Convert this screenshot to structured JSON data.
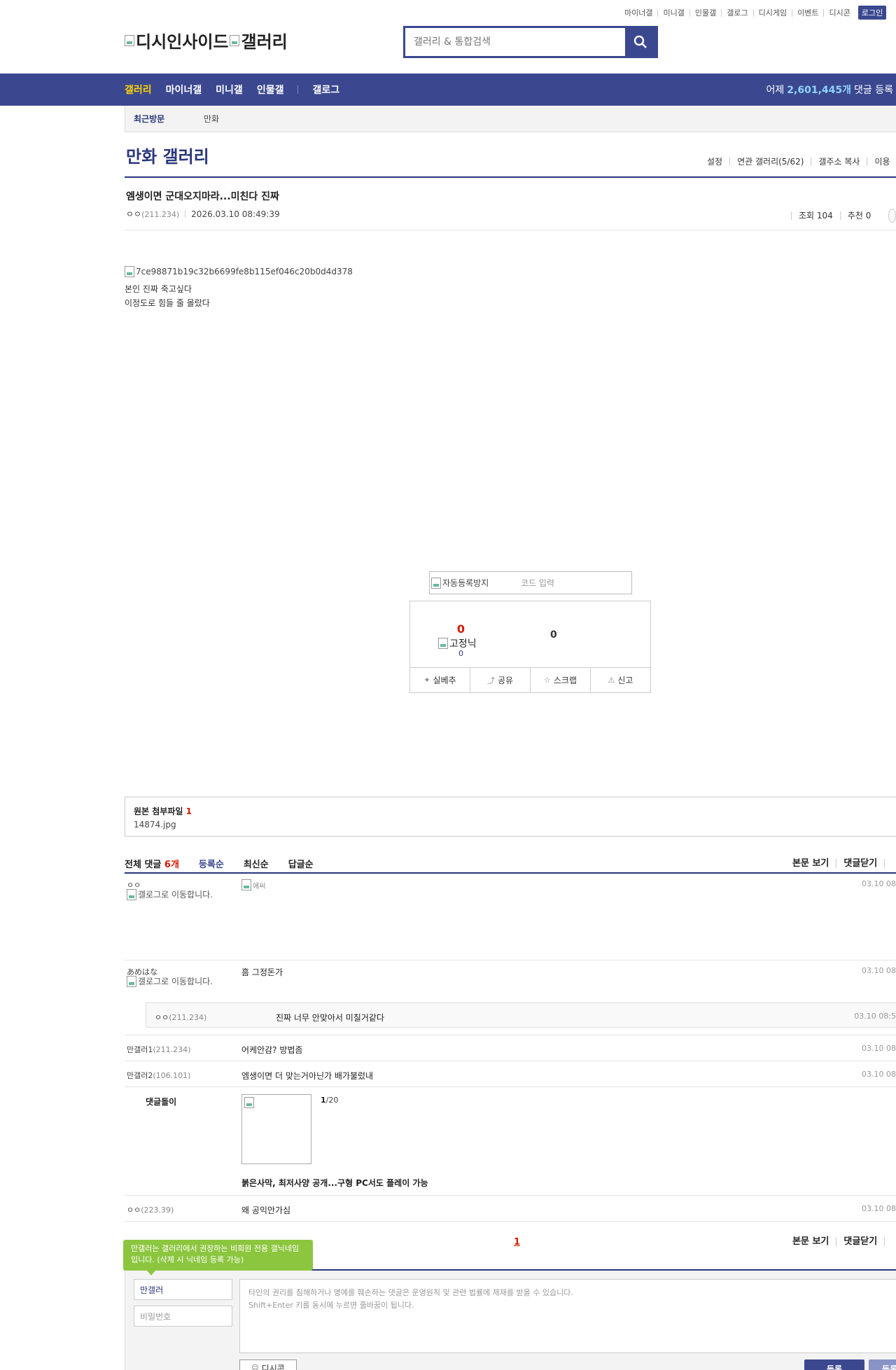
{
  "util_nav": [
    "마이너갤",
    "미니갤",
    "인물갤",
    "갤로그",
    "디시게임",
    "이벤트",
    "디시콘"
  ],
  "login_label": "로그인",
  "logo": {
    "alt1": "디시인사이드",
    "alt2": "갤러리"
  },
  "search": {
    "placeholder": "갤러리 & 통합검색"
  },
  "gnb": {
    "items": [
      "갤러리",
      "마이너갤",
      "미니갤",
      "인물갤",
      "갤로그"
    ],
    "stat_prefix": "어제",
    "stat_value": "2,601,445개",
    "stat_suffix": "댓글 등록"
  },
  "recent": {
    "label": "최근방문",
    "gallery": "만화"
  },
  "gallery": {
    "title": "만화 갤러리",
    "links": [
      "설정",
      "연관 갤러리(5/62)",
      "갤주소 복사",
      "이용"
    ]
  },
  "post": {
    "title": "엠생이면 군대오지마라...미친다 진짜",
    "author": "ㅇㅇ",
    "ip": "(211.234)",
    "date": "2026.03.10 08:49:39",
    "views_label": "조회 104",
    "recommend_label": "추천 0",
    "image_alt": "7ce98871b19c32b6699fe8b115ef046c20b0d4d378",
    "line1": "본인 진짜 죽고싶다",
    "line2": "이정도로 힘들 줄 몰랐다"
  },
  "captcha": {
    "image_alt": "자동등록방지",
    "placeholder": "코드 입력"
  },
  "vote": {
    "up_count": "0",
    "fixed_alt": "고정닉",
    "fixed_count": "0",
    "down_count": "0",
    "buttons": [
      "실베추",
      "공유",
      "스크랩",
      "신고"
    ]
  },
  "attachment": {
    "label": "원본 첨부파일",
    "count": "1",
    "filename": "14874.jpg"
  },
  "comments_header": {
    "total_label": "전체 댓글",
    "total_count": "6개",
    "sorts": [
      "등록순",
      "최신순",
      "답글순"
    ],
    "right": [
      "본문 보기",
      "댓글닫기"
    ]
  },
  "comments": [
    {
      "nick": "ㅇㅇ",
      "gallog_alt": "갤로그로 이동합니다.",
      "image_alt": "에씨",
      "date": "03.10 08"
    },
    {
      "nick": "あめはな",
      "gallog_alt": "갤로그로 이동합니다.",
      "text": "흠 그정돈가",
      "date": "03.10 08"
    },
    {
      "nick": "만갤러1",
      "ip": "(211.234)",
      "text": "어케안감? 방법좀",
      "date": "03.10 08"
    },
    {
      "nick": "만갤러2",
      "ip": "(106.101)",
      "text": "엠생이면 더 맞는거아닌가 배가불렀내",
      "date": "03.10 08"
    },
    {
      "nick": "ㅇㅇ",
      "ip": "(223.39)",
      "text": "왜 공익안가심",
      "date": "03.10 08"
    }
  ],
  "reply": {
    "nick": "ㅇㅇ",
    "ip": "(211.234)",
    "text": "진짜 너무 안맞아서 미칠거같다",
    "date": "03.10 08:5"
  },
  "comment_bot": {
    "label": "댓글돌이",
    "page_current": "1",
    "page_total": "/20",
    "headline": "붉은사막, 최저사양 공개...구형 PC서도 플레이 가능"
  },
  "comments_footer": {
    "page": "1",
    "right": [
      "본문 보기",
      "댓글닫기"
    ]
  },
  "write": {
    "tip": "만갤러는 갤러리에서 권장하는 비회원 전용 갤닉네임입니다. (삭제 시 닉네임 등록 가능)",
    "nick_value": "만갤러",
    "password_placeholder": "비밀번호",
    "textarea_line1": "타인의 권리를 침해하거나 명예를 훼손하는 댓글은 운영원칙 및 관련 법률에 제재를 받을 수 있습니다.",
    "textarea_line2": "Shift+Enter 키를 동시에 누르면 줄바꿈이 됩니다.",
    "dccon_label": "디시콘",
    "submit_label": "등록",
    "submit2_label": "등록"
  },
  "colors": {
    "brand": "#3b4890",
    "accent_yellow": "#ffd400",
    "red": "#d31900",
    "tip_green": "#8cc63f"
  }
}
